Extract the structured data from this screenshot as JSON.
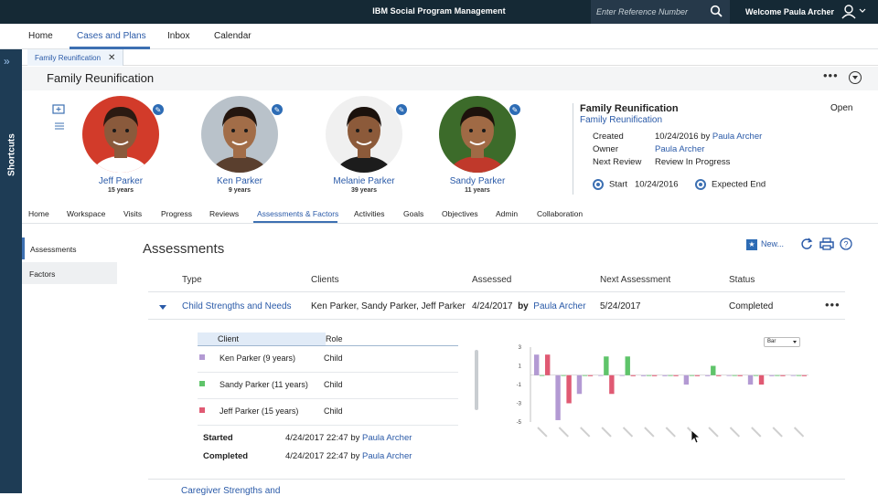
{
  "topbar": {
    "app_title": "IBM Social Program Management",
    "search_placeholder": "Enter Reference Number",
    "welcome": "Welcome Paula Archer"
  },
  "nav": {
    "tabs": [
      "Home",
      "Cases and Plans",
      "Inbox",
      "Calendar"
    ],
    "active": "Cases and Plans"
  },
  "shortcuts": {
    "label": "Shortcuts"
  },
  "content_tab": {
    "label": "Family Reunification"
  },
  "page": {
    "title": "Family Reunification"
  },
  "family": [
    {
      "name": "Jeff Parker",
      "age": "15 years",
      "bg": "#d23b2a",
      "skin": "#8a5a3c",
      "hair": "#2b1a12"
    },
    {
      "name": "Ken Parker",
      "age": "9 years",
      "bg": "#b9c2ca",
      "skin": "#a26d48",
      "hair": "#24160f"
    },
    {
      "name": "Melanie Parker",
      "age": "39 years",
      "bg": "#f0f0f0",
      "skin": "#8c5a3a",
      "hair": "#1b110c"
    },
    {
      "name": "Sandy Parker",
      "age": "11 years",
      "bg": "#3c6b2a",
      "skin": "#a06a45",
      "hair": "#1d120c"
    }
  ],
  "case": {
    "title": "Family Reunification",
    "subtitle": "Family Reunification",
    "status": "Open",
    "created_label": "Created",
    "created_date": "10/24/2016 by",
    "created_by": "Paula Archer",
    "owner_label": "Owner",
    "owner": "Paula Archer",
    "next_review_label": "Next Review",
    "next_review": "Review In Progress",
    "start_label": "Start",
    "start_date": "10/24/2016",
    "end_label": "Expected End"
  },
  "case_tabs": {
    "items": [
      "Home",
      "Workspace",
      "Visits",
      "Progress",
      "Reviews",
      "Assessments & Factors",
      "Activities",
      "Goals",
      "Objectives",
      "Admin",
      "Collaboration"
    ],
    "active": "Assessments & Factors"
  },
  "left_nav": {
    "items": [
      "Assessments",
      "Factors"
    ],
    "selected": "Assessments"
  },
  "assessments": {
    "heading": "Assessments",
    "new_label": "New...",
    "columns": [
      "Type",
      "Clients",
      "Assessed",
      "Next Assessment",
      "Status"
    ],
    "row": {
      "type": "Child Strengths and Needs",
      "clients": "Ken Parker, Sandy Parker, Jeff Parker",
      "assessed": "4/24/2017",
      "by": "by",
      "assessor": "Paula Archer",
      "next": "5/24/2017",
      "status": "Completed"
    },
    "sub_columns": [
      "Client",
      "Role"
    ],
    "sub_rows": [
      {
        "client": "Ken Parker (9 years)",
        "role": "Child",
        "color": "#b39ad3"
      },
      {
        "client": "Sandy Parker (11 years)",
        "role": "Child",
        "color": "#5fc46a"
      },
      {
        "client": "Jeff Parker (15 years)",
        "role": "Child",
        "color": "#e05a73"
      }
    ],
    "started_label": "Started",
    "started": "4/24/2017 22:47 by",
    "started_by": "Paula Archer",
    "completed_label": "Completed",
    "completed": "4/24/2017 22:47 by",
    "completed_by": "Paula Archer",
    "next_row_type": "Caregiver Strengths and"
  },
  "chart_data": {
    "type": "bar",
    "chart_selector": "Bar",
    "ylim": [
      -5,
      3
    ],
    "yticks": [
      "3",
      "1",
      "-1",
      "-3",
      "-5"
    ],
    "grid": false,
    "legend": "none",
    "categories": [
      "1",
      "2",
      "3",
      "4",
      "5",
      "6",
      "7",
      "8",
      "9",
      "10",
      "11",
      "12",
      "13"
    ],
    "series": [
      {
        "color": "#b39ad3",
        "values": [
          2.2,
          -4.8,
          -2.0,
          0.0,
          0.0,
          -0.1,
          -0.1,
          -1.0,
          -0.1,
          0.0,
          -1.0,
          -0.1,
          0.0
        ]
      },
      {
        "color": "#5fc46a",
        "values": [
          0.0,
          0.0,
          0.0,
          2.0,
          2.0,
          0.0,
          0.0,
          0.0,
          1.0,
          0.0,
          0.0,
          0.0,
          0.0
        ]
      },
      {
        "color": "#e05a73",
        "values": [
          2.2,
          -3.0,
          -0.1,
          -2.0,
          -0.1,
          -0.1,
          -0.1,
          -0.1,
          -0.1,
          -0.1,
          -1.0,
          -0.1,
          -0.1
        ]
      }
    ]
  }
}
